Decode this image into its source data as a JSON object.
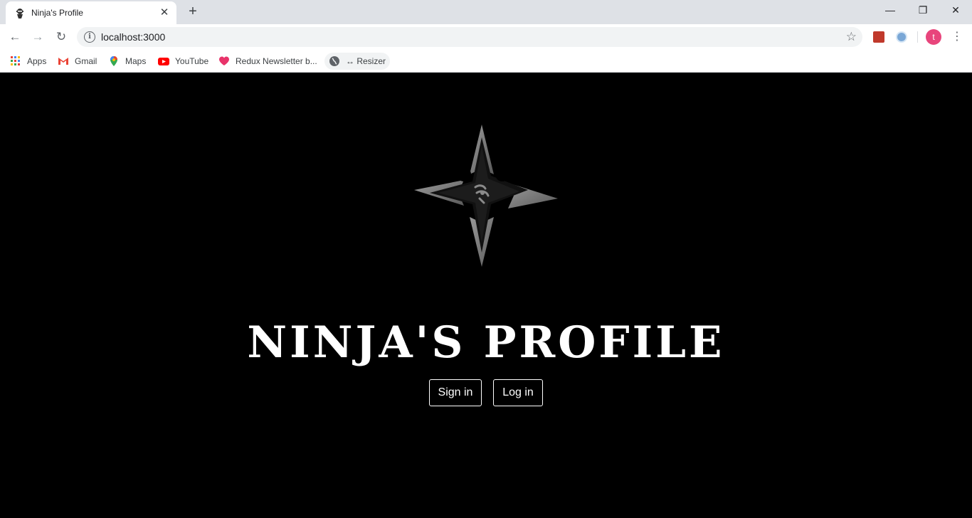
{
  "browser": {
    "tab": {
      "title": "Ninja's Profile",
      "close_icon": "close-icon"
    },
    "new_tab_icon": "plus-icon",
    "window_controls": {
      "minimize": "—",
      "restore": "❐",
      "close": "✕"
    },
    "nav": {
      "back": "←",
      "forward": "→",
      "reload": "↻"
    },
    "address_bar": {
      "url": "localhost:3000",
      "info_icon": "i",
      "star": "☆"
    },
    "profile_initial": "t",
    "menu": "⋮"
  },
  "bookmarks": [
    {
      "label": "Apps",
      "icon": "apps-grid-icon"
    },
    {
      "label": "Gmail",
      "icon": "gmail-icon"
    },
    {
      "label": "Maps",
      "icon": "maps-pin-icon"
    },
    {
      "label": "YouTube",
      "icon": "youtube-icon"
    },
    {
      "label": "Redux Newsletter b...",
      "icon": "heart-icon"
    },
    {
      "label": "↔ Resizer",
      "icon": "globe-icon"
    }
  ],
  "page": {
    "title": "NINJA'S PROFILE",
    "buttons": {
      "sign_in": "Sign in",
      "log_in": "Log in"
    },
    "colors": {
      "background": "#000000",
      "text": "#ffffff",
      "shuriken": "#8a8a8a"
    }
  }
}
